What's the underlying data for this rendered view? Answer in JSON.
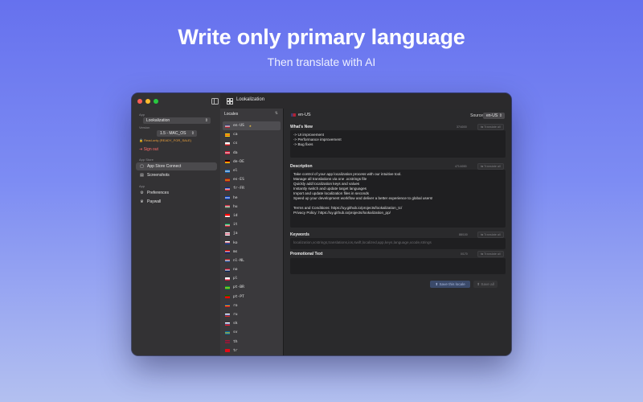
{
  "hero": {
    "title": "Write only primary language",
    "subtitle": "Then translate with AI"
  },
  "window": {
    "title": "Lookalization"
  },
  "sidebar": {
    "app_label": "App",
    "app_value": "Lookalization",
    "version_label": "Version",
    "version_value": "1.5 - MAC_OS",
    "readonly_text": "Read-only (READY_FOR_SALE)",
    "signout_label": "Sign out",
    "appstore_section": "App Store",
    "items_store": [
      {
        "label": "App Store Connect",
        "icon": "app-store-icon",
        "active": true
      },
      {
        "label": "Screenshots",
        "icon": "screenshots-icon",
        "active": false
      }
    ],
    "app_section": "App",
    "items_app": [
      {
        "label": "Preferences",
        "icon": "gear-icon"
      },
      {
        "label": "Paywall",
        "icon": "crown-icon"
      }
    ]
  },
  "locales": {
    "header": "Locales",
    "items": [
      {
        "code": "en-US",
        "primary": true,
        "colors": [
          "#3c3b6e",
          "#ffffff",
          "#b22234"
        ]
      },
      {
        "code": "ca",
        "colors": [
          "#fcdd09",
          "#da121a",
          "#fcdd09"
        ]
      },
      {
        "code": "cs",
        "colors": [
          "#ffffff",
          "#ffffff",
          "#d7141a"
        ]
      },
      {
        "code": "da",
        "colors": [
          "#c8102e",
          "#ffffff",
          "#c8102e"
        ]
      },
      {
        "code": "de-DE",
        "colors": [
          "#000000",
          "#dd0000",
          "#ffce00"
        ]
      },
      {
        "code": "el",
        "colors": [
          "#0d5eaf",
          "#ffffff",
          "#0d5eaf"
        ]
      },
      {
        "code": "es-ES",
        "colors": [
          "#aa151b",
          "#f1bf00",
          "#aa151b"
        ]
      },
      {
        "code": "fr-FR",
        "colors": [
          "#002395",
          "#ffffff",
          "#ed2939"
        ]
      },
      {
        "code": "he",
        "colors": [
          "#0038b8",
          "#ffffff",
          "#0038b8"
        ]
      },
      {
        "code": "hu",
        "colors": [
          "#cd2a3e",
          "#ffffff",
          "#436f4d"
        ]
      },
      {
        "code": "id",
        "colors": [
          "#ff0000",
          "#ff0000",
          "#ffffff"
        ]
      },
      {
        "code": "it",
        "colors": [
          "#009246",
          "#ffffff",
          "#ce2b37"
        ]
      },
      {
        "code": "ja",
        "colors": [
          "#ffffff",
          "#bc002d",
          "#ffffff"
        ]
      },
      {
        "code": "ko",
        "colors": [
          "#ffffff",
          "#cd2e3a",
          "#0047a0"
        ]
      },
      {
        "code": "ms",
        "colors": [
          "#cc0001",
          "#ffffff",
          "#010066"
        ]
      },
      {
        "code": "nl-NL",
        "colors": [
          "#ae1c28",
          "#ffffff",
          "#21468b"
        ]
      },
      {
        "code": "no",
        "colors": [
          "#ba0c2f",
          "#ffffff",
          "#00205b"
        ]
      },
      {
        "code": "pl",
        "colors": [
          "#ffffff",
          "#ffffff",
          "#dc143c"
        ]
      },
      {
        "code": "pt-BR",
        "colors": [
          "#009c3b",
          "#ffdf00",
          "#009c3b"
        ]
      },
      {
        "code": "pt-PT",
        "colors": [
          "#006600",
          "#ff0000",
          "#ff0000"
        ]
      },
      {
        "code": "ro",
        "colors": [
          "#002b7f",
          "#fcd116",
          "#ce1126"
        ]
      },
      {
        "code": "ru",
        "colors": [
          "#ffffff",
          "#0039a6",
          "#d52b1e"
        ]
      },
      {
        "code": "sk",
        "colors": [
          "#ffffff",
          "#0b4ea2",
          "#ee1c25"
        ]
      },
      {
        "code": "sv",
        "colors": [
          "#006aa7",
          "#fecc00",
          "#006aa7"
        ]
      },
      {
        "code": "th",
        "colors": [
          "#a51931",
          "#2d2a4a",
          "#a51931"
        ]
      },
      {
        "code": "tr",
        "colors": [
          "#e30a17",
          "#e30a17",
          "#e30a17"
        ]
      }
    ]
  },
  "detail": {
    "locale": "en-US",
    "source_label": "Source",
    "source_value": "en-US",
    "whats_new": {
      "label": "What's New",
      "count": "37/4000",
      "translate_label": "Translate all",
      "text": "-> UI improvement\n-> Performance improvement\n-> Bug fixes"
    },
    "description": {
      "label": "Description",
      "count": "471/4000",
      "translate_label": "Translate all",
      "text": "Take control of your app localization process with our intuitive tool.\nManage all translations via one .xcstrings file\nQuickly add localization keys and values\nInstantly switch and update target languages\nImport and update localization files in seconds\nSpeed up your development workflow and deliver a better experience to global users!\n\nTerms and Conditions: https://uy.github.io/projects/lookalization_tc/\nPrivacy Policy: https://uy.github.io/projects/lookalization_pp/"
    },
    "keywords": {
      "label": "Keywords",
      "count": "88/100",
      "translate_label": "Translate all",
      "placeholder": "localization,xcstrings,translations,ios,swift,localized,app,keys,language,xcode,strings"
    },
    "promo": {
      "label": "Promotional Text",
      "count": "0/170",
      "translate_label": "Translate all",
      "text": ""
    },
    "save_locale_label": "Save this locale",
    "save_all_label": "Save all"
  }
}
